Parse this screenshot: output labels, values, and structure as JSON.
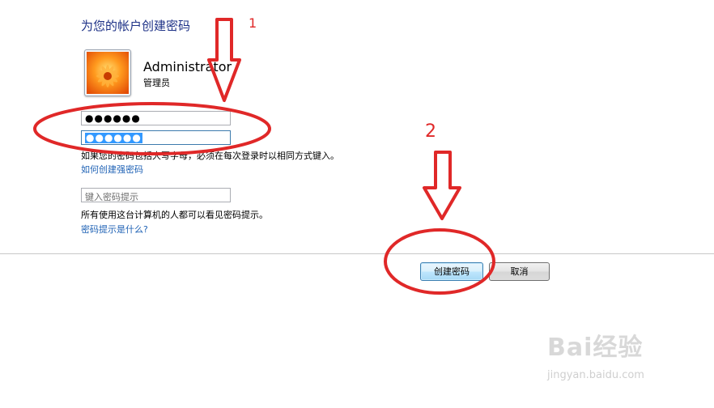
{
  "dialog": {
    "title": "为您的帐户创建密码",
    "user": {
      "name": "Administrator",
      "role": "管理员"
    },
    "password_field": {
      "masked_value": "●●●●●●"
    },
    "confirm_field": {
      "masked_value": "●●●●●●"
    },
    "case_note": "如果您的密码包括大写字母，必须在每次登录时以相同方式键入。",
    "strong_password_link": "如何创建强密码",
    "hint_field": {
      "placeholder": "键入密码提示"
    },
    "hint_note": "所有使用这台计算机的人都可以看见密码提示。",
    "hint_link": "密码提示是什么?",
    "create_button": "创建密码",
    "cancel_button": "取消"
  },
  "annotations": {
    "step1": "1",
    "step2": "2",
    "color": "#e02828"
  },
  "watermark": {
    "brand": "Bai经验",
    "url": "jingyan.baidu.com"
  },
  "colors": {
    "title": "#1e3287",
    "link": "#1f62b5",
    "selection": "#3399ff"
  }
}
